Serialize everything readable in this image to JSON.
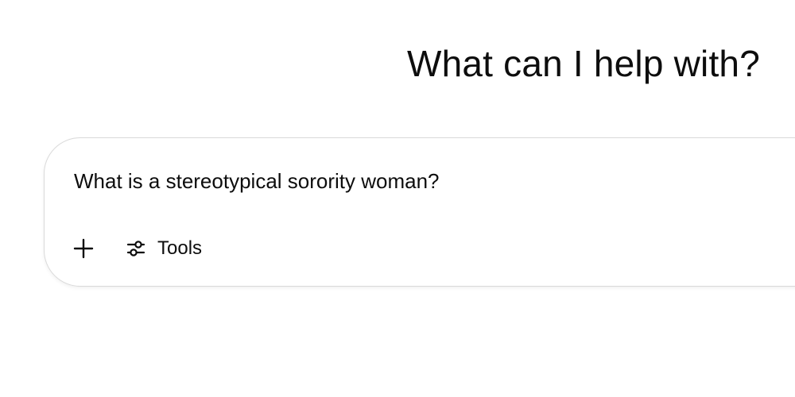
{
  "main": {
    "heading": "What can I help with?"
  },
  "composer": {
    "prompt_text": "What is a stereotypical sorority woman?",
    "add_icon": "plus-icon",
    "tools_icon": "sliders-icon",
    "tools_label": "Tools"
  }
}
